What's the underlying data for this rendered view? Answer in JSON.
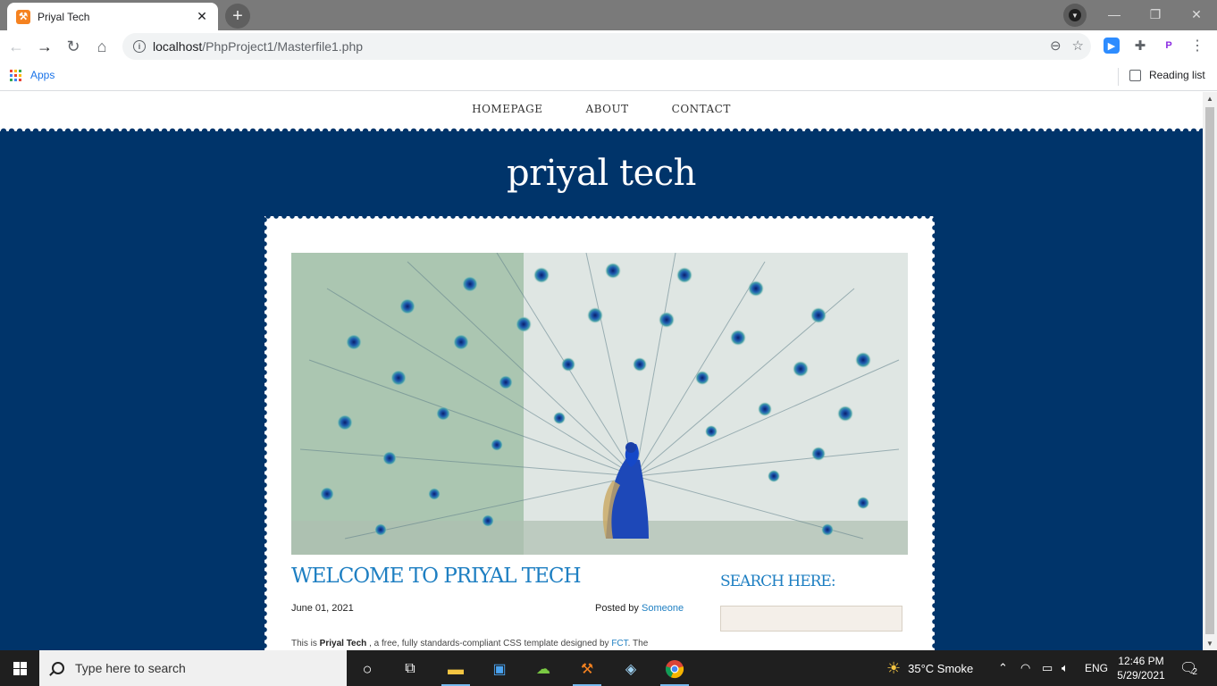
{
  "browser": {
    "tab_title": "Priyal Tech",
    "tab_favicon": "xampp-icon",
    "url_host": "localhost",
    "url_path": "/PhpProject1/Masterfile1.php",
    "bookmarks": {
      "apps_label": "Apps",
      "reading_list_label": "Reading list"
    }
  },
  "site": {
    "nav": [
      "HOMEPAGE",
      "ABOUT",
      "CONTACT"
    ],
    "title": "priyal tech",
    "post": {
      "title": "WELCOME TO PRIYAL TECH",
      "date": "June 01, 2021",
      "posted_by_prefix": "Posted by ",
      "author": "Someone",
      "body_prefix": "This is ",
      "body_bold": "Priyal Tech",
      "body_middle": " , a free, fully standards-compliant CSS template designed by ",
      "body_link": "FCT",
      "body_suffix": ". The"
    },
    "sidebar": {
      "search_heading": "SEARCH HERE:"
    }
  },
  "taskbar": {
    "search_placeholder": "Type here to search",
    "weather": "35°C  Smoke",
    "language": "ENG",
    "time": "12:46 PM",
    "date": "5/29/2021",
    "notification_count": "2"
  },
  "colors": {
    "site_blue": "#00346a",
    "accent": "#1e7fc2"
  }
}
